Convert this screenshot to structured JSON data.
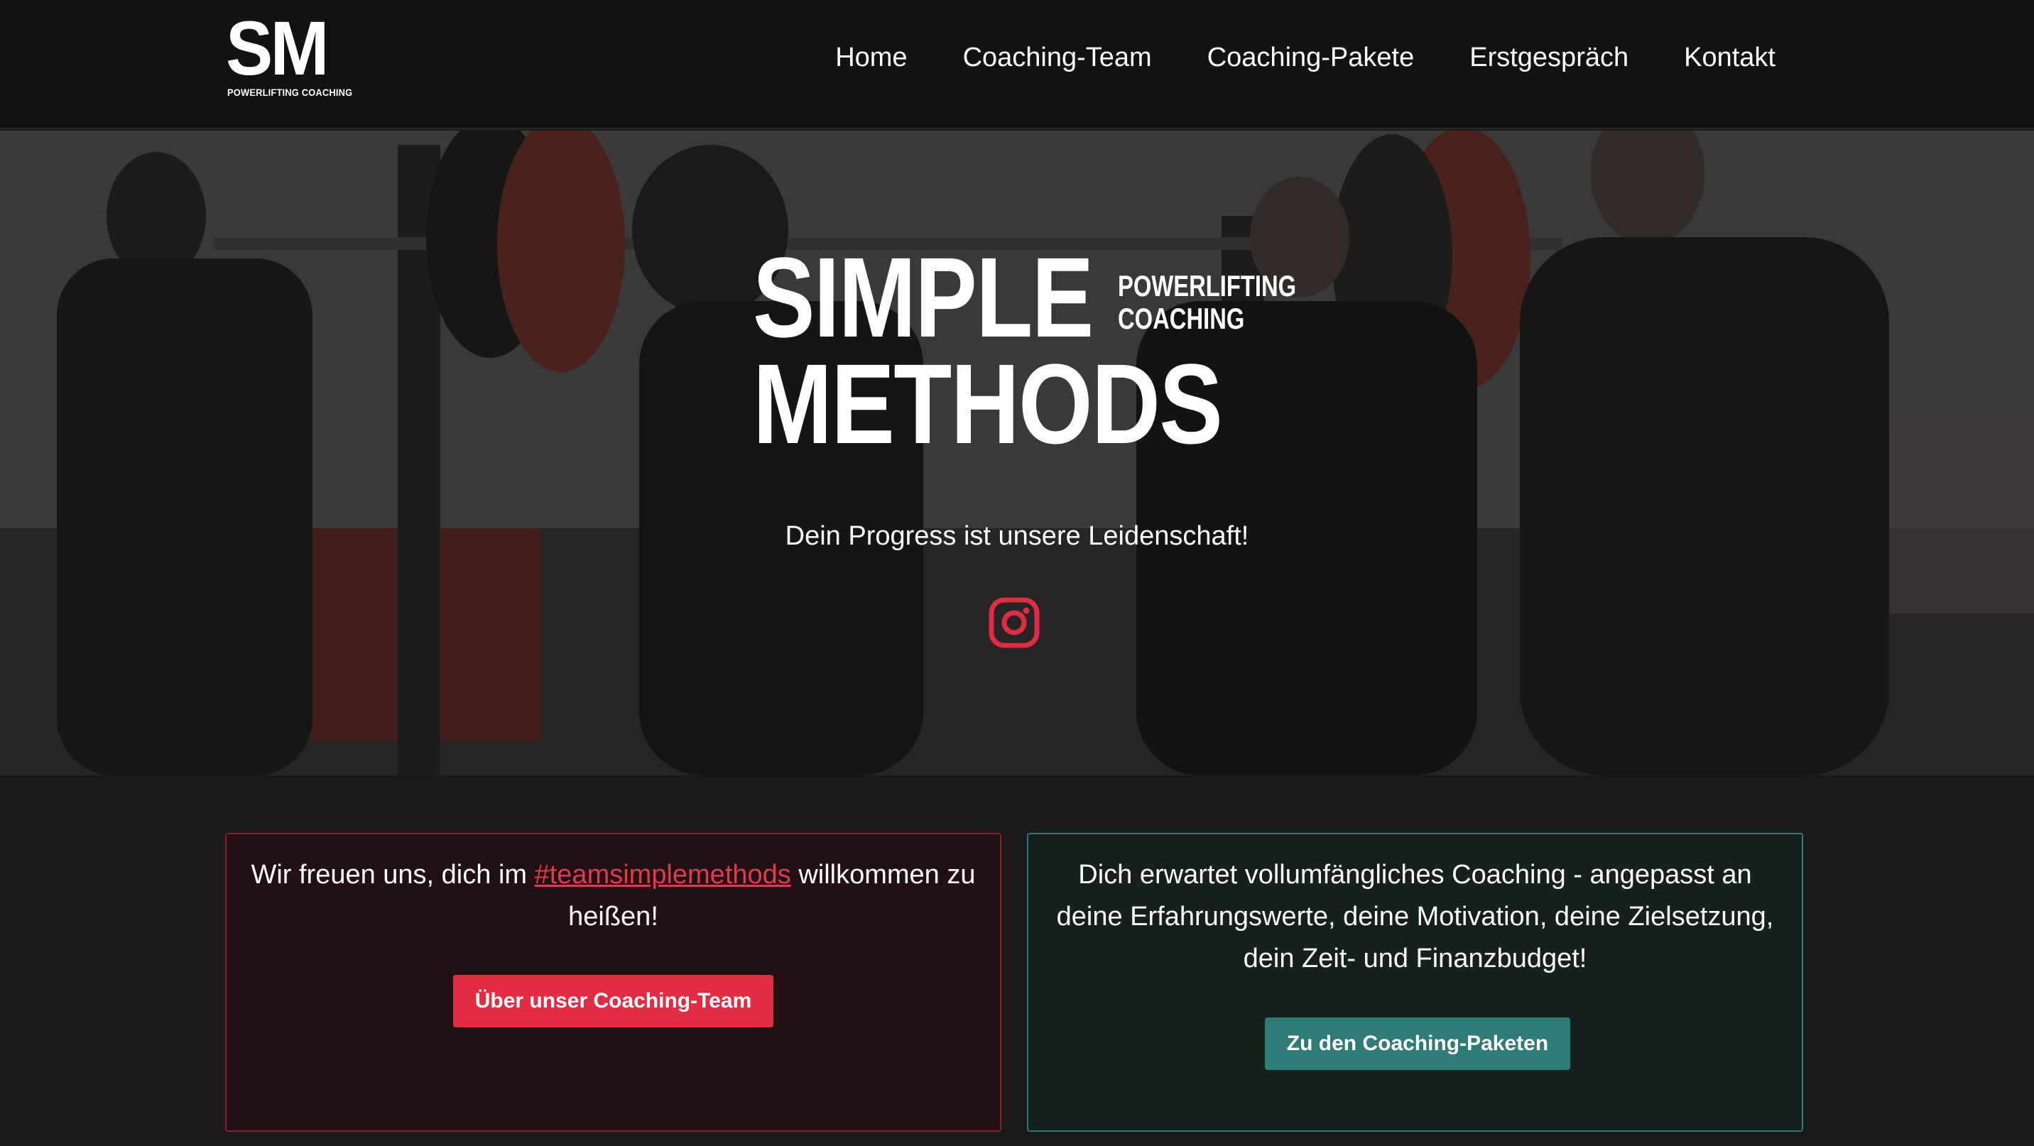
{
  "header": {
    "logo": {
      "mark": "SM",
      "subtitle": "POWERLIFTING COACHING"
    },
    "nav": [
      {
        "label": "Home"
      },
      {
        "label": "Coaching-Team"
      },
      {
        "label": "Coaching-Pakete"
      },
      {
        "label": "Erstgespräch"
      },
      {
        "label": "Kontakt"
      }
    ]
  },
  "hero": {
    "brand_line1": "SIMPLE",
    "brand_tag_line1": "POWERLIFTING",
    "brand_tag_line2": "COACHING",
    "brand_line2": "METHODS",
    "tagline": "Dein Progress ist unsere Leidenschaft!",
    "social_icon": "instagram-icon"
  },
  "cards": {
    "team": {
      "text_before": "Wir freuen uns, dich im ",
      "hashtag": "#teamsimplemethods",
      "text_after": " willkommen zu heißen!",
      "button_label": "Über unser Coaching-Team"
    },
    "packages": {
      "text": "Dich erwartet vollumfängliches Coaching - angepasst an deine Erfahrungswerte, deine Motivation, deine Zielsetzung, dein Zeit- und Finanzbudget!",
      "button_label": "Zu den Coaching-Paketen"
    }
  },
  "colors": {
    "accent_red": "#e02d44",
    "accent_teal": "#2f7b78",
    "background": "#1b1a1b",
    "navbar": "#131213"
  }
}
